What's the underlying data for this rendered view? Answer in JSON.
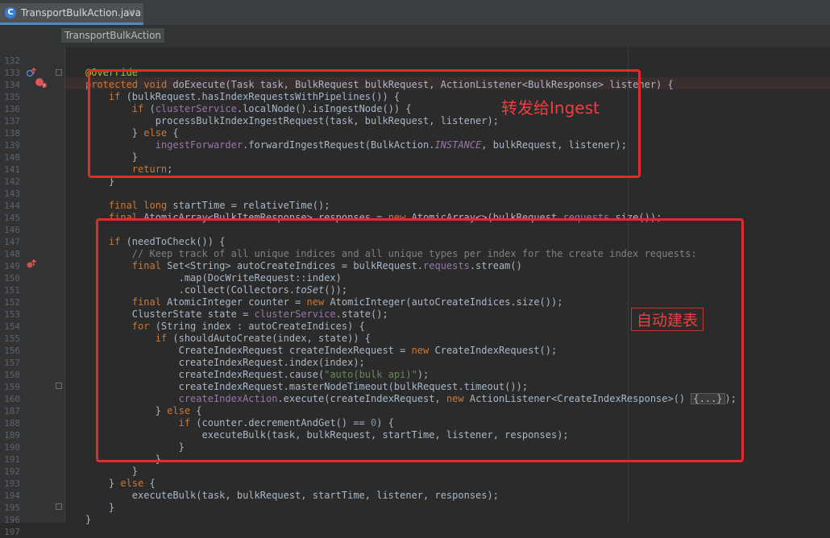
{
  "editor": {
    "tab": {
      "icon": "class-c-icon",
      "icon_letter": "C",
      "title": "TransportBulkAction.java",
      "close": "×"
    },
    "breadcrumb": "TransportBulkAction",
    "colors": {
      "background": "#2b2b2b",
      "keyword": "#cc7832",
      "field": "#9876aa",
      "string": "#6a8759",
      "number": "#6897bb",
      "comment": "#808080",
      "annotation": "#bbb529",
      "annotation_box": "#e32b2b"
    },
    "gutter_icons": [
      "override-method-icon",
      "breakpoint-icon",
      "overridden-method-icon"
    ],
    "lines": [
      {
        "n": "132",
        "t": ""
      },
      {
        "n": "133",
        "t": "@Override"
      },
      {
        "n": "134",
        "t": "protected void doExecute(Task task, BulkRequest bulkRequest, ActionListener<BulkResponse> listener) {"
      },
      {
        "n": "135",
        "t": "    if (bulkRequest.hasIndexRequestsWithPipelines()) {"
      },
      {
        "n": "136",
        "t": "        if (clusterService.localNode().isIngestNode()) {"
      },
      {
        "n": "137",
        "t": "            processBulkIndexIngestRequest(task, bulkRequest, listener);"
      },
      {
        "n": "138",
        "t": "        } else {"
      },
      {
        "n": "139",
        "t": "            ingestForwarder.forwardIngestRequest(BulkAction.INSTANCE, bulkRequest, listener);"
      },
      {
        "n": "140",
        "t": "        }"
      },
      {
        "n": "141",
        "t": "        return;"
      },
      {
        "n": "142",
        "t": "    }"
      },
      {
        "n": "143",
        "t": ""
      },
      {
        "n": "144",
        "t": "    final long startTime = relativeTime();"
      },
      {
        "n": "145",
        "t": "    final AtomicArray<BulkItemResponse> responses = new AtomicArray<>(bulkRequest.requests.size());"
      },
      {
        "n": "146",
        "t": ""
      },
      {
        "n": "147",
        "t": "    if (needToCheck()) {"
      },
      {
        "n": "148",
        "t": "        // Keep track of all unique indices and all unique types per index for the create index requests:"
      },
      {
        "n": "149",
        "t": "        final Set<String> autoCreateIndices = bulkRequest.requests.stream()"
      },
      {
        "n": "150",
        "t": "                .map(DocWriteRequest::index)"
      },
      {
        "n": "151",
        "t": "                .collect(Collectors.toSet());"
      },
      {
        "n": "152",
        "t": "        final AtomicInteger counter = new AtomicInteger(autoCreateIndices.size());"
      },
      {
        "n": "153",
        "t": "        ClusterState state = clusterService.state();"
      },
      {
        "n": "154",
        "t": "        for (String index : autoCreateIndices) {"
      },
      {
        "n": "155",
        "t": "            if (shouldAutoCreate(index, state)) {"
      },
      {
        "n": "156",
        "t": "                CreateIndexRequest createIndexRequest = new CreateIndexRequest();"
      },
      {
        "n": "157",
        "t": "                createIndexRequest.index(index);"
      },
      {
        "n": "158",
        "t": "                createIndexRequest.cause(\"auto(bulk api)\");"
      },
      {
        "n": "159",
        "t": "                createIndexRequest.masterNodeTimeout(bulkRequest.timeout());"
      },
      {
        "n": "160",
        "t": "                createIndexAction.execute(createIndexRequest, new ActionListener<CreateIndexResponse>() {...});"
      },
      {
        "n": "187",
        "t": "            } else {"
      },
      {
        "n": "188",
        "t": "                if (counter.decrementAndGet() == 0) {"
      },
      {
        "n": "189",
        "t": "                    executeBulk(task, bulkRequest, startTime, listener, responses);"
      },
      {
        "n": "190",
        "t": "                }"
      },
      {
        "n": "191",
        "t": "            }"
      },
      {
        "n": "192",
        "t": "        }"
      },
      {
        "n": "193",
        "t": "    } else {"
      },
      {
        "n": "194",
        "t": "        executeBulk(task, bulkRequest, startTime, listener, responses);"
      },
      {
        "n": "195",
        "t": "    }"
      },
      {
        "n": "196",
        "t": "}"
      },
      {
        "n": "197",
        "t": ""
      }
    ],
    "annotations": [
      {
        "text": "转发给Ingest"
      },
      {
        "text": "自动建表"
      }
    ]
  }
}
